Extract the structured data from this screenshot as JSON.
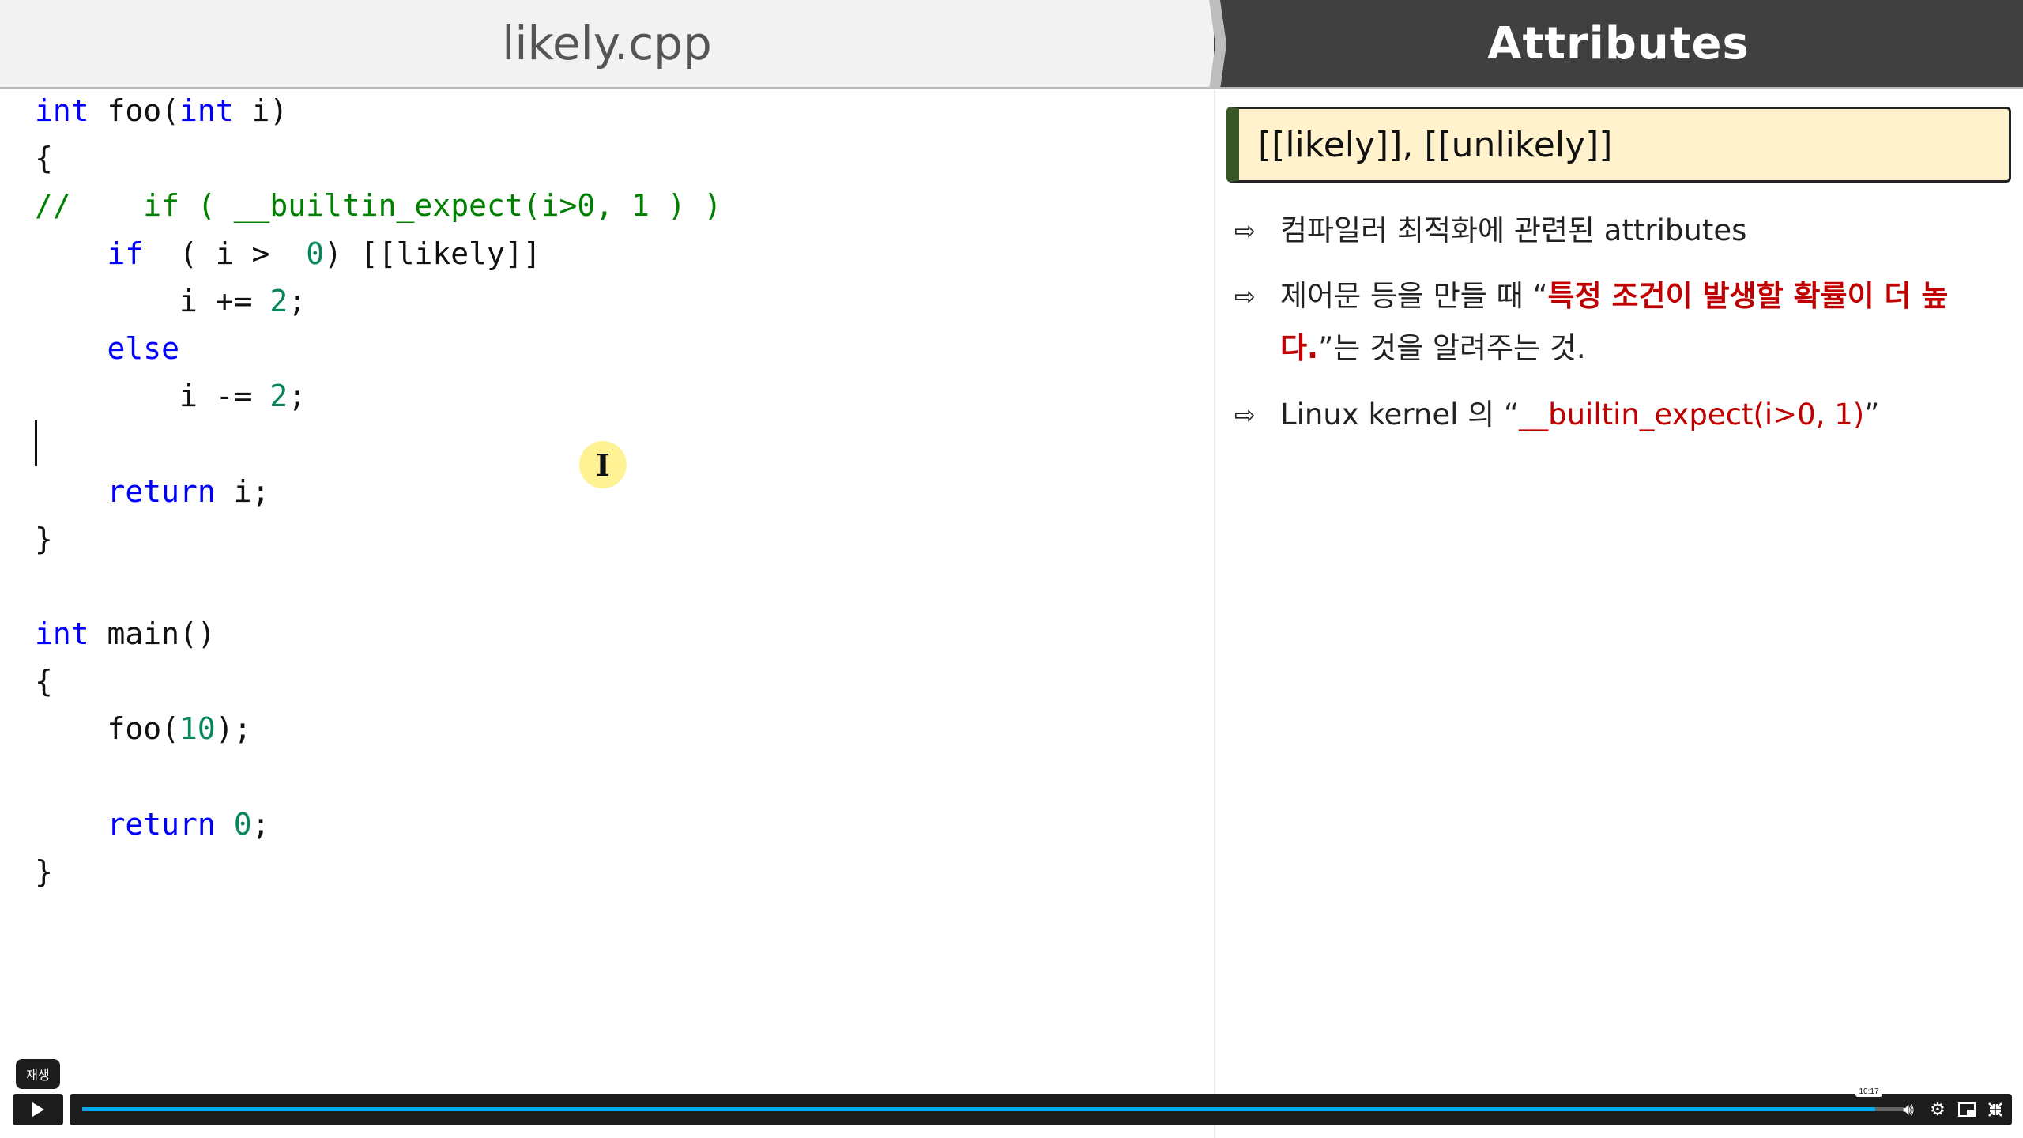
{
  "editor": {
    "filename": "likely.cpp",
    "lines": [
      [
        [
          "int",
          "kw"
        ],
        [
          " foo(",
          "tx"
        ],
        [
          "int",
          "kw"
        ],
        [
          " i)",
          "tx"
        ]
      ],
      [
        [
          "{",
          "tx"
        ]
      ],
      [
        [
          "//    if ( __builtin_expect(i>0, 1 ) )",
          "cm"
        ]
      ],
      [
        [
          "    ",
          "tx"
        ],
        [
          "if",
          "kw"
        ],
        [
          "  ( i >  ",
          "tx"
        ],
        [
          "0",
          "num"
        ],
        [
          ") [[likely]]",
          "tx"
        ]
      ],
      [
        [
          "        i += ",
          "tx"
        ],
        [
          "2",
          "num"
        ],
        [
          ";",
          "tx"
        ]
      ],
      [
        [
          "    ",
          "tx"
        ],
        [
          "else",
          "kw"
        ]
      ],
      [
        [
          "        i -= ",
          "tx"
        ],
        [
          "2",
          "num"
        ],
        [
          ";",
          "tx"
        ]
      ],
      [
        [
          "",
          "tx"
        ]
      ],
      [
        [
          "    ",
          "tx"
        ],
        [
          "return",
          "kw"
        ],
        [
          " i;",
          "tx"
        ]
      ],
      [
        [
          "}",
          "tx"
        ]
      ],
      [
        [
          "",
          "tx"
        ]
      ],
      [
        [
          "int",
          "kw"
        ],
        [
          " main()",
          "tx"
        ]
      ],
      [
        [
          "{",
          "tx"
        ]
      ],
      [
        [
          "    foo(",
          "tx"
        ],
        [
          "10",
          "num"
        ],
        [
          ");",
          "tx"
        ]
      ],
      [
        [
          "",
          "tx"
        ]
      ],
      [
        [
          "    ",
          "tx"
        ],
        [
          "return",
          "kw"
        ],
        [
          " ",
          "tx"
        ],
        [
          "0",
          "num"
        ],
        [
          ";",
          "tx"
        ]
      ],
      [
        [
          "}",
          "tx"
        ]
      ]
    ]
  },
  "slide": {
    "title": "Attributes",
    "box_title": "[[likely]], [[unlikely]]",
    "bullet_arrow": "⇨",
    "bullet1": "컴파일러 최적화에 관련된 attributes",
    "bullet2_pre": "제어문 등을 만들 때 “",
    "bullet2_red": "특정 조건이 발생할 확률이 더 높다.",
    "bullet2_post": "”는 것을 알려주는 것.",
    "bullet3_pre": "Linux kernel 의  “",
    "bullet3_red": "__builtin_expect(i>0, 1)",
    "bullet3_post": "”"
  },
  "player": {
    "play_tooltip": "재생",
    "time_tooltip": "10:17",
    "progress_fraction": 0.984,
    "accent": "#00adef"
  }
}
